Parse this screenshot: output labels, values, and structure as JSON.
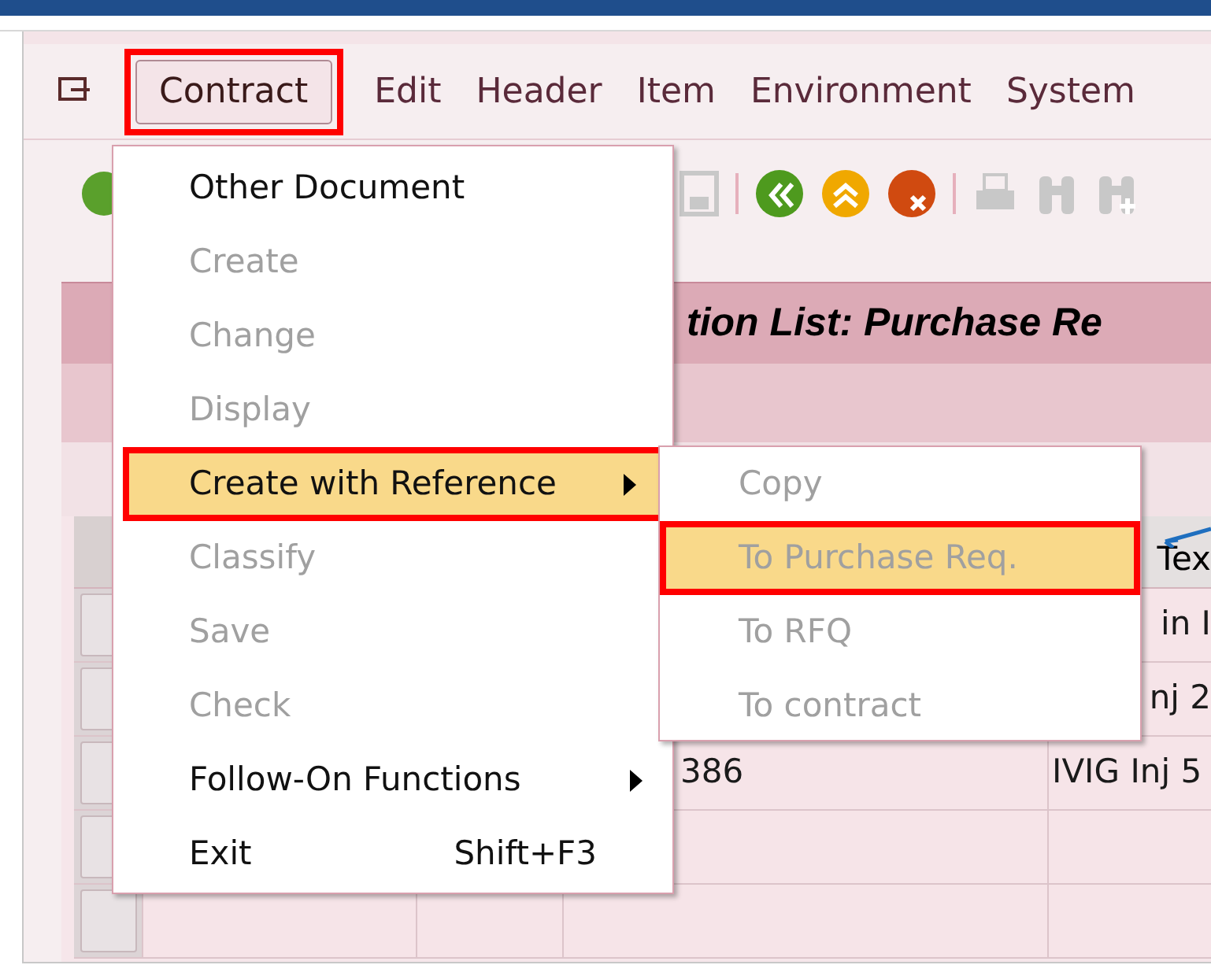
{
  "menu_bar": [
    {
      "label": "Contract",
      "selected": true,
      "annotated": true
    },
    {
      "label": "Edit",
      "selected": false,
      "annotated": false
    },
    {
      "label": "Header",
      "selected": false,
      "annotated": false
    },
    {
      "label": "Item",
      "selected": false,
      "annotated": false
    },
    {
      "label": "Environment",
      "selected": false,
      "annotated": false
    },
    {
      "label": "System",
      "selected": false,
      "annotated": false
    }
  ],
  "title": "tion List: Purchase Re",
  "table": {
    "columns": [
      "Tex"
    ],
    "rows": [
      {
        "column_2": "",
        "column_4": "in I"
      },
      {
        "column_2": "",
        "column_4": "nj 2"
      },
      {
        "column_2": "386",
        "column_4": "IVIG Inj 5"
      }
    ]
  },
  "menu": {
    "items": [
      {
        "label": "Other Document",
        "disabled": false,
        "submenu": false,
        "selected": false,
        "annotated": false
      },
      {
        "label": "Create",
        "disabled": true,
        "submenu": false,
        "selected": false,
        "annotated": false
      },
      {
        "label": "Change",
        "disabled": true,
        "submenu": false,
        "selected": false,
        "annotated": false
      },
      {
        "label": "Display",
        "disabled": true,
        "submenu": false,
        "selected": false,
        "annotated": false
      },
      {
        "label": "Create with Reference",
        "disabled": false,
        "submenu": true,
        "selected": true,
        "annotated": true
      },
      {
        "label": "Classify",
        "disabled": true,
        "submenu": false,
        "selected": false,
        "annotated": false
      },
      {
        "label": "Save",
        "disabled": true,
        "submenu": false,
        "selected": false,
        "annotated": false
      },
      {
        "label": "Check",
        "disabled": true,
        "submenu": false,
        "selected": false,
        "annotated": false
      },
      {
        "label": "Follow-On Functions",
        "disabled": false,
        "submenu": true,
        "selected": false,
        "annotated": false
      },
      {
        "label": "Exit",
        "disabled": false,
        "submenu": false,
        "selected": false,
        "annotated": false,
        "shortcut": "Shift+F3"
      }
    ]
  },
  "submenu": {
    "items": [
      {
        "label": "Copy",
        "disabled": true,
        "selected": false,
        "annotated": false
      },
      {
        "label": "To Purchase Req.",
        "disabled": true,
        "selected": true,
        "annotated": true
      },
      {
        "label": "To RFQ",
        "disabled": true,
        "selected": false,
        "annotated": false
      },
      {
        "label": "To contract",
        "disabled": true,
        "selected": false,
        "annotated": false
      }
    ]
  }
}
